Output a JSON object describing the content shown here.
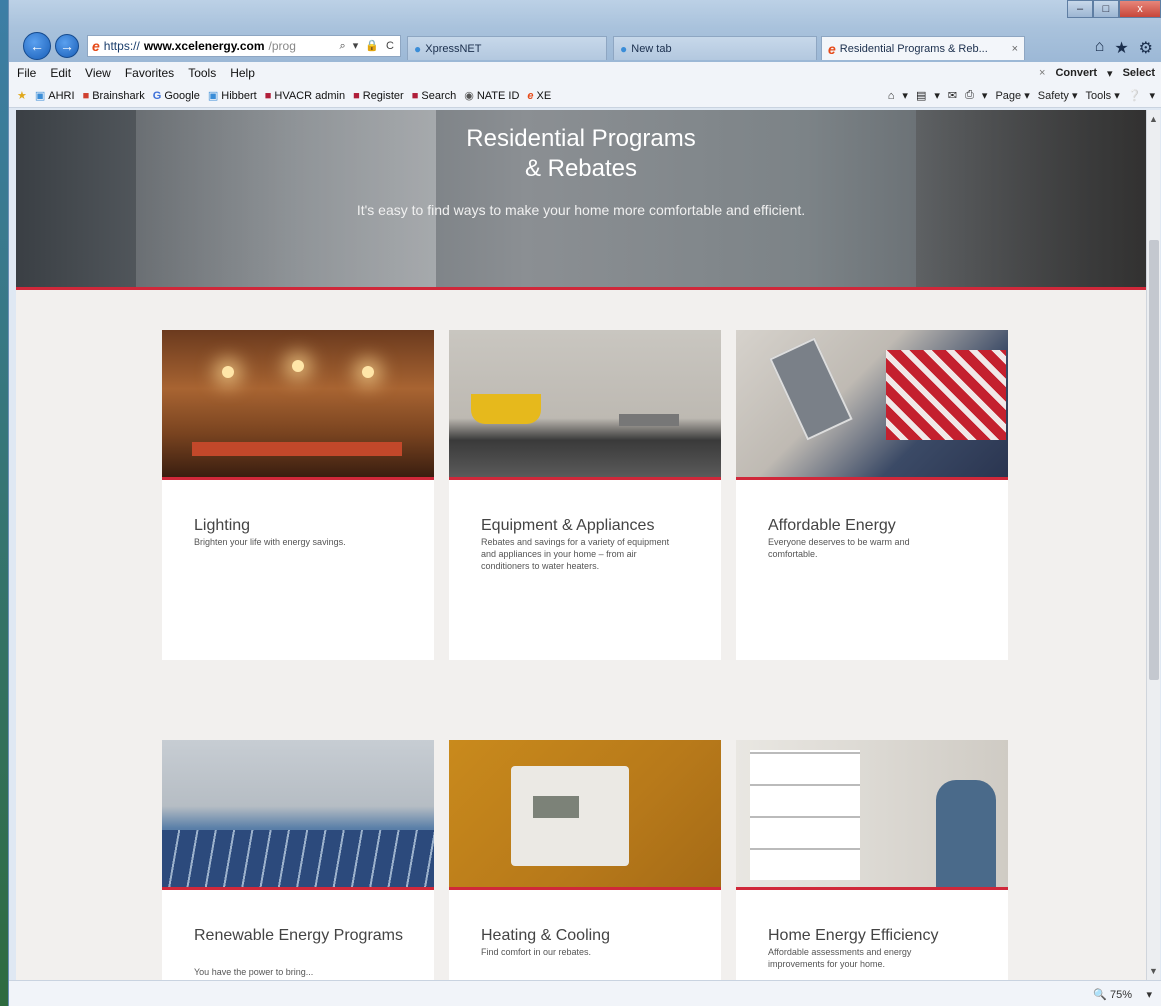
{
  "browser": {
    "address": {
      "scheme": "https://",
      "domain": "www.xcelenergy.com",
      "path": "/prog",
      "tools": "⌕ ▾ 🔒 C"
    },
    "tabs": [
      {
        "label": "XpressNET",
        "active": false
      },
      {
        "label": "New tab",
        "active": false
      },
      {
        "label": "Residential Programs & Reb...",
        "active": true,
        "close": "×"
      }
    ],
    "window_controls": [
      "–",
      "□",
      "x"
    ],
    "right_icons": [
      "⌂",
      "★",
      "⚙"
    ],
    "menu": [
      "File",
      "Edit",
      "View",
      "Favorites",
      "Tools",
      "Help"
    ],
    "menu_right": {
      "close": "×",
      "convert": "Convert",
      "convert_arrow": "▾",
      "select": "Select"
    },
    "favorites": [
      "AHRI",
      "Brainshark",
      "Google",
      "Hibbert",
      "HVACR admin",
      "Register",
      "Search",
      "NATE ID",
      "XE"
    ],
    "command_right": [
      "▾",
      "▾",
      "▾",
      "Page ▾",
      "Safety ▾",
      "Tools ▾",
      "▾"
    ],
    "zoom": "75%",
    "zoom_arrow": "▾"
  },
  "hero": {
    "title_line1": "Residential Programs",
    "title_line2": "& Rebates",
    "subtitle": "It's easy to find ways to make your home more comfortable and efficient."
  },
  "cards": [
    {
      "title": "Lighting",
      "desc": "Brighten your life with energy savings."
    },
    {
      "title": "Equipment & Appliances",
      "desc": "Rebates and savings for a variety of equipment and appliances in your home – from air conditioners to water heaters."
    },
    {
      "title": "Affordable Energy",
      "desc": "Everyone deserves to be warm and comfortable."
    },
    {
      "title": "Renewable Energy Programs",
      "desc": "You have the power to bring..."
    },
    {
      "title": "Heating & Cooling",
      "desc": "Find comfort in our rebates."
    },
    {
      "title": "Home Energy Efficiency",
      "desc": "Affordable assessments and energy improvements for your home."
    }
  ],
  "colors": {
    "accent": "#d0283a"
  }
}
